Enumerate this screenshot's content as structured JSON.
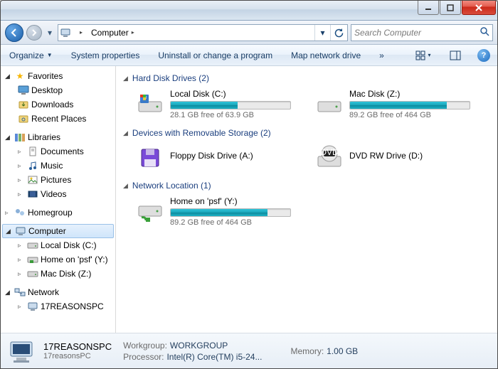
{
  "titlebar": {},
  "address": {
    "location": "Computer",
    "search_placeholder": "Search Computer"
  },
  "toolbar": {
    "organize": "Organize",
    "system_properties": "System properties",
    "uninstall": "Uninstall or change a program",
    "map_drive": "Map network drive",
    "more": "»"
  },
  "sidebar": {
    "favorites": {
      "label": "Favorites",
      "items": [
        "Desktop",
        "Downloads",
        "Recent Places"
      ]
    },
    "libraries": {
      "label": "Libraries",
      "items": [
        "Documents",
        "Music",
        "Pictures",
        "Videos"
      ]
    },
    "homegroup": {
      "label": "Homegroup"
    },
    "computer": {
      "label": "Computer",
      "items": [
        "Local Disk (C:)",
        "Home on 'psf' (Y:)",
        "Mac Disk (Z:)"
      ]
    },
    "network": {
      "label": "Network",
      "items": [
        "17REASONSPC"
      ]
    }
  },
  "content": {
    "sections": {
      "hdd": {
        "title": "Hard Disk Drives (2)",
        "drives": [
          {
            "name": "Local Disk (C:)",
            "sub": "28.1 GB free of 63.9 GB",
            "fill": 56
          },
          {
            "name": "Mac Disk (Z:)",
            "sub": "89.2 GB free of 464 GB",
            "fill": 81
          }
        ]
      },
      "rem": {
        "title": "Devices with Removable Storage (2)",
        "drives": [
          {
            "name": "Floppy Disk Drive (A:)"
          },
          {
            "name": "DVD RW Drive (D:)"
          }
        ]
      },
      "net": {
        "title": "Network Location (1)",
        "drives": [
          {
            "name": "Home on 'psf' (Y:)",
            "sub": "89.2 GB free of 464 GB",
            "fill": 81
          }
        ]
      }
    }
  },
  "details": {
    "name": "17REASONSPC",
    "sub": "17reasonsPC",
    "props": [
      {
        "k": "Workgroup:",
        "v": "WORKGROUP"
      },
      {
        "k": "Processor:",
        "v": "Intel(R) Core(TM) i5-24..."
      }
    ],
    "props2": [
      {
        "k": "Memory:",
        "v": "1.00 GB"
      }
    ]
  }
}
